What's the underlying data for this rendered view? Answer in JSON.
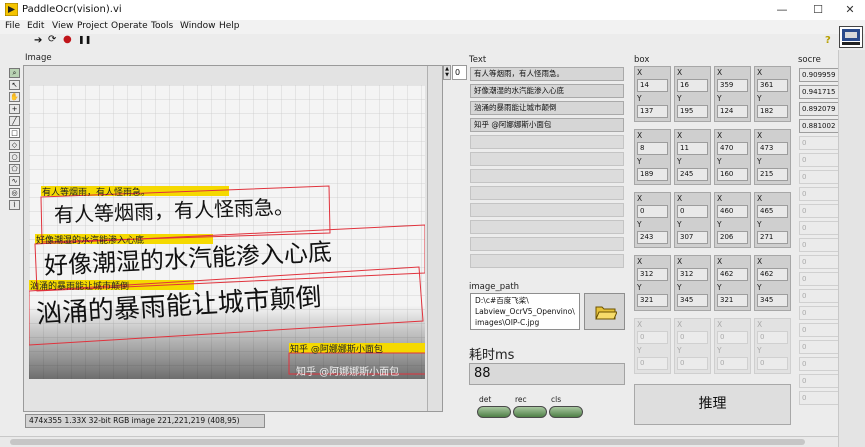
{
  "window": {
    "title": "PaddleOcr(vision).vi",
    "minimize": "—",
    "maximize": "☐",
    "close": "✕"
  },
  "menu": [
    "File",
    "Edit",
    "View",
    "Project",
    "Operate",
    "Tools",
    "Window",
    "Help"
  ],
  "toolbar": {
    "run": "➔",
    "run_continuous": "⟳",
    "abort": "●",
    "pause": "❚❚",
    "help": "?"
  },
  "image_panel": {
    "label": "Image",
    "status": "474x355 1.33X 32-bit RGB image 221,221,219     (408,95)",
    "ocr_lines": [
      "有人等烟雨，有人怪雨急。",
      "好像潮湿的水汽能渗入心底",
      "汹涌的暴雨能让城市颠倒",
      "知乎 @阿娜娜斯小面包"
    ],
    "handwriting": [
      "有人等烟雨，有人怪雨急。",
      "好像潮湿的水汽能渗入心底",
      "汹涌的暴雨能让城市颠倒"
    ],
    "watermark": "知乎 @阿娜娜斯小面包"
  },
  "text_panel": {
    "label": "Text",
    "index": "0",
    "items": [
      "有人等烟雨，有人怪雨急。",
      "好像潮湿的水汽能渗入心底",
      "汹涌的暴雨能让城市颠倒",
      "知乎 @阿娜娜斯小面包"
    ]
  },
  "box_panel": {
    "label": "box",
    "rows": [
      [
        {
          "x": "14",
          "y": "137"
        },
        {
          "x": "16",
          "y": "195"
        },
        {
          "x": "359",
          "y": "124"
        },
        {
          "x": "361",
          "y": "182"
        }
      ],
      [
        {
          "x": "8",
          "y": "189"
        },
        {
          "x": "11",
          "y": "245"
        },
        {
          "x": "470",
          "y": "160"
        },
        {
          "x": "473",
          "y": "215"
        }
      ],
      [
        {
          "x": "0",
          "y": "243"
        },
        {
          "x": "0",
          "y": "307"
        },
        {
          "x": "460",
          "y": "206"
        },
        {
          "x": "465",
          "y": "271"
        }
      ],
      [
        {
          "x": "312",
          "y": "321"
        },
        {
          "x": "312",
          "y": "345"
        },
        {
          "x": "462",
          "y": "321"
        },
        {
          "x": "462",
          "y": "345"
        }
      ],
      [
        {
          "x": "0",
          "y": "0"
        },
        {
          "x": "0",
          "y": "0"
        },
        {
          "x": "0",
          "y": "0"
        },
        {
          "x": "0",
          "y": "0"
        }
      ]
    ],
    "x_key": "X",
    "y_key": "Y"
  },
  "score_panel": {
    "label": "socre",
    "values": [
      "0.909959",
      "0.941715",
      "0.892079",
      "0.881002"
    ],
    "empty": "0"
  },
  "image_path": {
    "label": "image_path",
    "value": "D:\\c#百度飞桨\\Labview_OcrV5_Openvino\\images\\OIP-C.jpg",
    "lines": [
      "D:\\c#百度飞桨\\",
      "Labview_OcrV5_Openvino\\",
      "images\\OIP-C.jpg"
    ]
  },
  "timing": {
    "label": "耗时ms",
    "value": "88"
  },
  "leds": [
    {
      "label": "det"
    },
    {
      "label": "rec"
    },
    {
      "label": "cls"
    }
  ],
  "infer_button": {
    "label": "推理"
  }
}
